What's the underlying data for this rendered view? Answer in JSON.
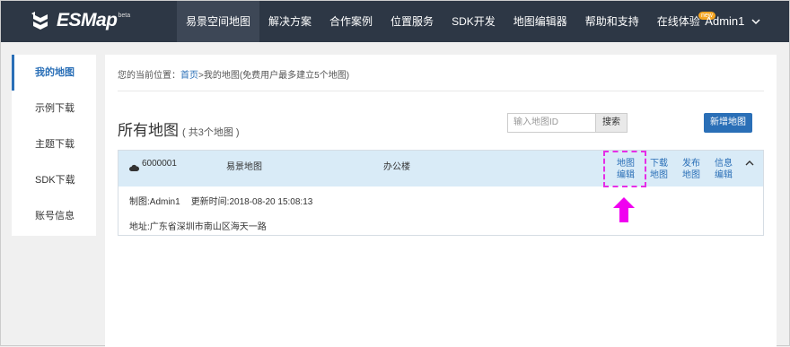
{
  "header": {
    "logo_text": "ESMap",
    "logo_badge": "beta",
    "nav": [
      {
        "label": "易景空间地图",
        "active": true
      },
      {
        "label": "解决方案"
      },
      {
        "label": "合作案例"
      },
      {
        "label": "位置服务"
      },
      {
        "label": "SDK开发"
      },
      {
        "label": "地图编辑器"
      },
      {
        "label": "帮助和支持"
      },
      {
        "label": "在线体验",
        "badge": "new"
      }
    ],
    "user": "Admin1"
  },
  "sidebar": {
    "items": [
      {
        "label": "我的地图",
        "active": true
      },
      {
        "label": "示例下载"
      },
      {
        "label": "主题下载"
      },
      {
        "label": "SDK下载"
      },
      {
        "label": "账号信息"
      }
    ]
  },
  "main": {
    "breadcrumb_prefix": "您的当前位置：",
    "breadcrumb_home": "首页",
    "breadcrumb_rest": ">我的地图(免费用户最多建立5个地图)",
    "title": "所有地图",
    "count": "( 共3个地图 )",
    "search_placeholder": "输入地图ID",
    "search_label": "搜索",
    "add_label": "新增地图"
  },
  "card": {
    "map_id": "6000001",
    "map_name": "易景地图",
    "map_type": "办公楼",
    "actions": [
      {
        "line1": "地图",
        "line2": "编辑"
      },
      {
        "line1": "下载",
        "line2": "地图"
      },
      {
        "line1": "发布",
        "line2": "地图"
      },
      {
        "line1": "信息",
        "line2": "编辑"
      }
    ],
    "creator": "制图:Admin1",
    "updated": "更新时间:2018-08-20 15:08:13",
    "address": "地址:广东省深圳市南山区海天一路"
  },
  "colors": {
    "topbar": "#2d3745",
    "accent": "#2a6fb7",
    "card_header": "#d9ebf7",
    "highlight": "#e62ee6"
  }
}
